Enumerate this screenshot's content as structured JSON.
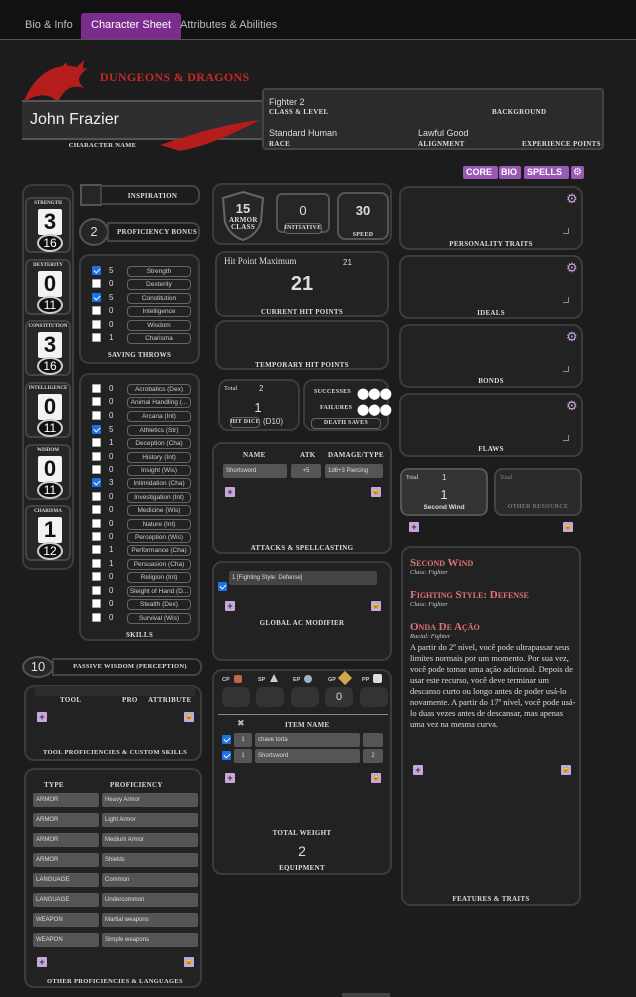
{
  "tabs": [
    "Bio & Info",
    "Character Sheet",
    "Attributes & Abilities"
  ],
  "header": {
    "logo": "DUNGEONS & DRAGONS",
    "character_name": "John Frazier",
    "character_name_label": "CHARACTER NAME",
    "class_level": "Fighter 2",
    "class_level_label": "CLASS & LEVEL",
    "background_label": "BACKGROUND",
    "race": "Standard Human",
    "race_label": "RACE",
    "alignment": "Lawful Good",
    "alignment_label": "ALIGNMENT",
    "xp_label": "EXPERIENCE POINTS"
  },
  "toggles": [
    "CORE",
    "BIO",
    "SPELLS"
  ],
  "abilities": [
    {
      "name": "STRENGTH",
      "mod": "3",
      "score": "16"
    },
    {
      "name": "DEXTERITY",
      "mod": "0",
      "score": "11"
    },
    {
      "name": "CONSTITUTION",
      "mod": "3",
      "score": "16"
    },
    {
      "name": "INTELLIGENCE",
      "mod": "0",
      "score": "11"
    },
    {
      "name": "WISDOM",
      "mod": "0",
      "score": "11"
    },
    {
      "name": "CHARISMA",
      "mod": "1",
      "score": "12"
    }
  ],
  "inspiration_label": "INSPIRATION",
  "proficiency": {
    "value": "2",
    "label": "PROFICIENCY BONUS"
  },
  "saves": {
    "label": "SAVING THROWS",
    "items": [
      {
        "v": "5",
        "n": "Strength",
        "p": true
      },
      {
        "v": "0",
        "n": "Dexterity",
        "p": false
      },
      {
        "v": "5",
        "n": "Constitution",
        "p": true
      },
      {
        "v": "0",
        "n": "Intelligence",
        "p": false
      },
      {
        "v": "0",
        "n": "Wisdom",
        "p": false
      },
      {
        "v": "1",
        "n": "Charisma",
        "p": false
      }
    ]
  },
  "skills": {
    "label": "SKILLS",
    "items": [
      {
        "v": "0",
        "n": "Acrobatics (Dex)",
        "p": false
      },
      {
        "v": "0",
        "n": "Animal Handling (...",
        "p": false
      },
      {
        "v": "0",
        "n": "Arcana (Int)",
        "p": false
      },
      {
        "v": "5",
        "n": "Athletics (Str)",
        "p": true
      },
      {
        "v": "1",
        "n": "Deception (Cha)",
        "p": false
      },
      {
        "v": "0",
        "n": "History (Int)",
        "p": false
      },
      {
        "v": "0",
        "n": "Insight (Wis)",
        "p": false
      },
      {
        "v": "3",
        "n": "Intimidation (Cha)",
        "p": true
      },
      {
        "v": "0",
        "n": "Investigation (Int)",
        "p": false
      },
      {
        "v": "0",
        "n": "Medicine (Wis)",
        "p": false
      },
      {
        "v": "0",
        "n": "Nature (Int)",
        "p": false
      },
      {
        "v": "0",
        "n": "Perception (Wis)",
        "p": false
      },
      {
        "v": "1",
        "n": "Performance (Cha)",
        "p": false
      },
      {
        "v": "1",
        "n": "Persuasion (Cha)",
        "p": false
      },
      {
        "v": "0",
        "n": "Religion (Int)",
        "p": false
      },
      {
        "v": "0",
        "n": "Sleight of Hand (D...",
        "p": false
      },
      {
        "v": "0",
        "n": "Stealth (Dex)",
        "p": false
      },
      {
        "v": "0",
        "n": "Survival (Wis)",
        "p": false
      }
    ]
  },
  "passive": {
    "value": "10",
    "label": "PASSIVE WISDOM (PERCEPTION)"
  },
  "tools": {
    "label": "TOOL PROFICIENCIES & CUSTOM SKILLS",
    "col_tool": "TOOL",
    "col_pro": "PRO",
    "col_attr": "ATTRIBUTE"
  },
  "other_prof": {
    "label": "OTHER PROFICIENCIES & LANGUAGES",
    "col_type": "TYPE",
    "col_prof": "PROFICIENCY",
    "items": [
      {
        "t": "ARMOR",
        "p": "Heavy Armor"
      },
      {
        "t": "ARMOR",
        "p": "Light Armor"
      },
      {
        "t": "ARMOR",
        "p": "Medium Armor"
      },
      {
        "t": "ARMOR",
        "p": "Shields"
      },
      {
        "t": "LANGUAGE",
        "p": "Common"
      },
      {
        "t": "LANGUAGE",
        "p": "Undercommon"
      },
      {
        "t": "WEAPON",
        "p": "Martial weapons"
      },
      {
        "t": "WEAPON",
        "p": "Simple weapons"
      }
    ]
  },
  "combat": {
    "ac": "15",
    "ac_label": "ARMOR CLASS",
    "initiative": "0",
    "initiative_label": "INITIATIVE",
    "speed": "30",
    "speed_label": "SPEED"
  },
  "hp": {
    "max_label": "Hit Point Maximum",
    "max": "21",
    "current": "21",
    "current_label": "CURRENT HIT POINTS",
    "temp_label": "TEMPORARY HIT POINTS"
  },
  "hit_dice": {
    "total_label": "Total",
    "total": "2",
    "value": "1",
    "die": "(D10)",
    "label": "HIT DICE"
  },
  "death": {
    "successes": "SUCCESSES",
    "failures": "FAILURES",
    "label": "DEATH SAVES"
  },
  "attacks": {
    "label": "ATTACKS & SPELLCASTING",
    "col_name": "NAME",
    "col_atk": "ATK",
    "col_dmg": "DAMAGE/TYPE",
    "items": [
      {
        "name": "Shortsword",
        "atk": "+5",
        "dmg": "1d6+3 Piercing"
      }
    ]
  },
  "ac_mod": {
    "label": "GLOBAL AC MODIFIER",
    "item": "1 [Fighting Style: Defense]"
  },
  "coins": [
    {
      "k": "CP",
      "v": ""
    },
    {
      "k": "SP",
      "v": ""
    },
    {
      "k": "EP",
      "v": ""
    },
    {
      "k": "GP",
      "v": "0"
    },
    {
      "k": "PP",
      "v": ""
    }
  ],
  "equipment": {
    "label": "EQUIPMENT",
    "col_name": "ITEM NAME",
    "weight_label": "TOTAL WEIGHT",
    "weight": "2",
    "items": [
      {
        "qty": "1",
        "name": "chave torta",
        "w": ""
      },
      {
        "qty": "1",
        "name": "Shortsword",
        "w": "2"
      }
    ]
  },
  "traits": {
    "personality": "PERSONALITY TRAITS",
    "ideals": "IDEALS",
    "bonds": "BONDS",
    "flaws": "FLAWS"
  },
  "resources": {
    "total_label": "Total",
    "total": "1",
    "value": "1",
    "name": "Second Wind",
    "other_total_label": "Total",
    "other_label": "OTHER RESOURCE"
  },
  "features": {
    "label": "FEATURES & TRAITS",
    "items": [
      {
        "title": "Second Wind",
        "sub": "Class: Fighter",
        "desc": ""
      },
      {
        "title": "Fighting Style: Defense",
        "sub": "Class: Fighter",
        "desc": ""
      },
      {
        "title": "Onda De Ação",
        "sub": "Racial: Fighter",
        "desc": "A partir do 2º nível, você pode ultrapassar seus limites normais por um momento. Por sua vez, você pode tomar uma ação adicional. Depois de usar este recurso, você deve terminar um descanso curto ou longo antes de poder usá-lo novamente. A partir do 17º nível, você pode usá-lo duas vezes antes de descansar, mas apenas uma vez na mesma curva."
      }
    ]
  },
  "colors": {
    "accent": "#7b2d8e",
    "button": "#c9a6dd",
    "feature_title": "#e57373",
    "check": "#1a73e8"
  }
}
